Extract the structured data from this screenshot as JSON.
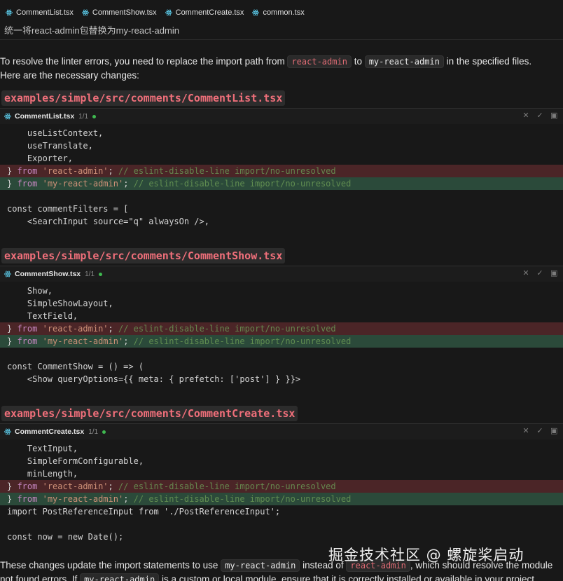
{
  "tabs": [
    {
      "label": "CommentList.tsx",
      "icon": "react-icon"
    },
    {
      "label": "CommentShow.tsx",
      "icon": "react-icon"
    },
    {
      "label": "CommentCreate.tsx",
      "icon": "react-icon"
    },
    {
      "label": "common.tsx",
      "icon": "react-icon"
    }
  ],
  "prompt": "统一将react-admin包替换为my-react-admin",
  "intro": {
    "part1": "To resolve the linter errors, you need to replace the import path from ",
    "code1": "react-admin",
    "part2": " to ",
    "code2": "my-react-admin",
    "part3": " in the specified files.",
    "line2": "Here are the necessary changes:"
  },
  "files": [
    {
      "heading": "examples/simple/src/comments/CommentList.tsx",
      "name": "CommentList.tsx",
      "count": "1/1",
      "lines": [
        "    useListContext,",
        "    useTranslate,",
        "    Exporter,"
      ],
      "del": "} from 'react-admin'; // eslint-disable-line import/no-unresolved",
      "add": "} from 'my-react-admin'; // eslint-disable-line import/no-unresolved",
      "after": [
        "",
        "const commentFilters = [",
        "    <SearchInput source=\"q\" alwaysOn />,"
      ]
    },
    {
      "heading": "examples/simple/src/comments/CommentShow.tsx",
      "name": "CommentShow.tsx",
      "count": "1/1",
      "lines": [
        "    Show,",
        "    SimpleShowLayout,",
        "    TextField,"
      ],
      "del": "} from 'react-admin'; // eslint-disable-line import/no-unresolved",
      "add": "} from 'my-react-admin'; // eslint-disable-line import/no-unresolved",
      "after": [
        "",
        "const CommentShow = () => (",
        "    <Show queryOptions={{ meta: { prefetch: ['post'] } }}>"
      ]
    },
    {
      "heading": "examples/simple/src/comments/CommentCreate.tsx",
      "name": "CommentCreate.tsx",
      "count": "1/1",
      "lines": [
        "    TextInput,",
        "    SimpleFormConfigurable,",
        "    minLength,"
      ],
      "del": "} from 'react-admin'; // eslint-disable-line import/no-unresolved",
      "add": "} from 'my-react-admin'; // eslint-disable-line import/no-unresolved",
      "after": [
        "import PostReferenceInput from './PostReferenceInput';",
        "",
        "const now = new Date();"
      ]
    }
  ],
  "footer": {
    "part1": "These changes update the import statements to use ",
    "code1": "my-react-admin",
    "part2": " instead of ",
    "code2": "react-admin",
    "part3": ", which should resolve the module",
    "line2a": "not found errors. If ",
    "code3": "my-react-admin",
    "line2b": " is a custom or local module, ensure that it is correctly installed or available in your project."
  },
  "watermark": "掘金技术社区 @ 螺旋桨启动",
  "colors": {
    "accent_red": "#ef6f7a",
    "diff_del": "#4b2527",
    "diff_add": "#2b4a3a",
    "status_dot": "#3fb950"
  }
}
